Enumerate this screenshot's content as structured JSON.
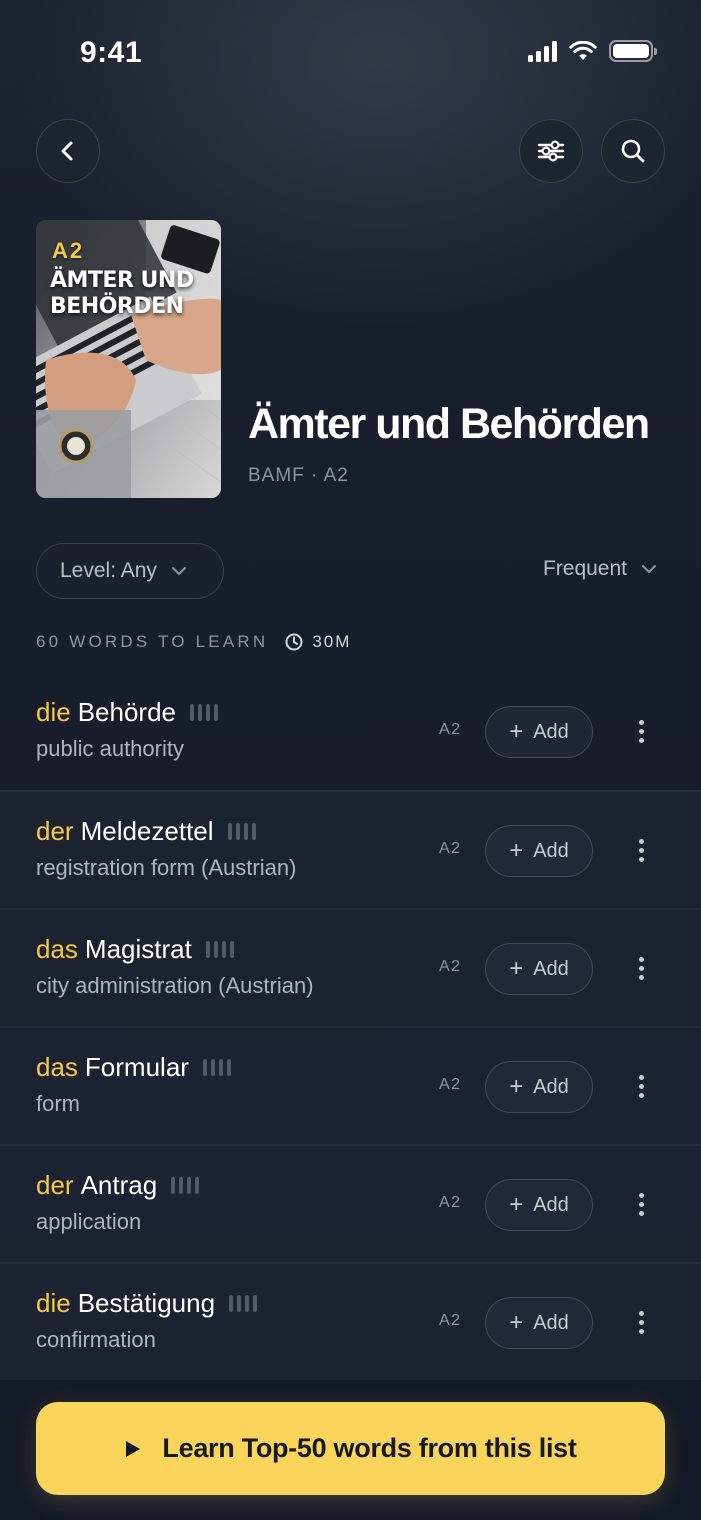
{
  "status_bar": {
    "time": "9:41"
  },
  "header": {
    "back_icon": "chevron-left-icon",
    "filter_icon": "sliders-icon",
    "search_icon": "search-icon"
  },
  "cover": {
    "level": "A2",
    "title_line1": "ÄMTER UND",
    "title_line2": "BEHÖRDEN"
  },
  "list": {
    "title": "Ämter und Behörden",
    "meta": "BAMF · A2"
  },
  "filters": {
    "level_label": "Level: Any",
    "sort_label": "Frequent"
  },
  "summary": {
    "words_label": "60 WORDS TO LEARN",
    "duration": "30M"
  },
  "words": [
    {
      "article": "die",
      "noun": "Behörde",
      "translation": "public authority",
      "level": "A2",
      "add_label": "Add"
    },
    {
      "article": "der",
      "noun": "Meldezettel",
      "translation": "registration form (Austrian)",
      "level": "A2",
      "add_label": "Add"
    },
    {
      "article": "das",
      "noun": "Magistrat",
      "translation": "city administration (Austrian)",
      "level": "A2",
      "add_label": "Add"
    },
    {
      "article": "das",
      "noun": "Formular",
      "translation": "form",
      "level": "A2",
      "add_label": "Add"
    },
    {
      "article": "der",
      "noun": "Antrag",
      "translation": "application",
      "level": "A2",
      "add_label": "Add"
    },
    {
      "article": "die",
      "noun": "Bestätigung",
      "translation": "confirmation",
      "level": "A2",
      "add_label": "Add"
    }
  ],
  "cta": {
    "label": "Learn Top-50 words from this list"
  },
  "colors": {
    "accent": "#fbd45b",
    "article": "#f6c94a",
    "background": "#151a26"
  }
}
